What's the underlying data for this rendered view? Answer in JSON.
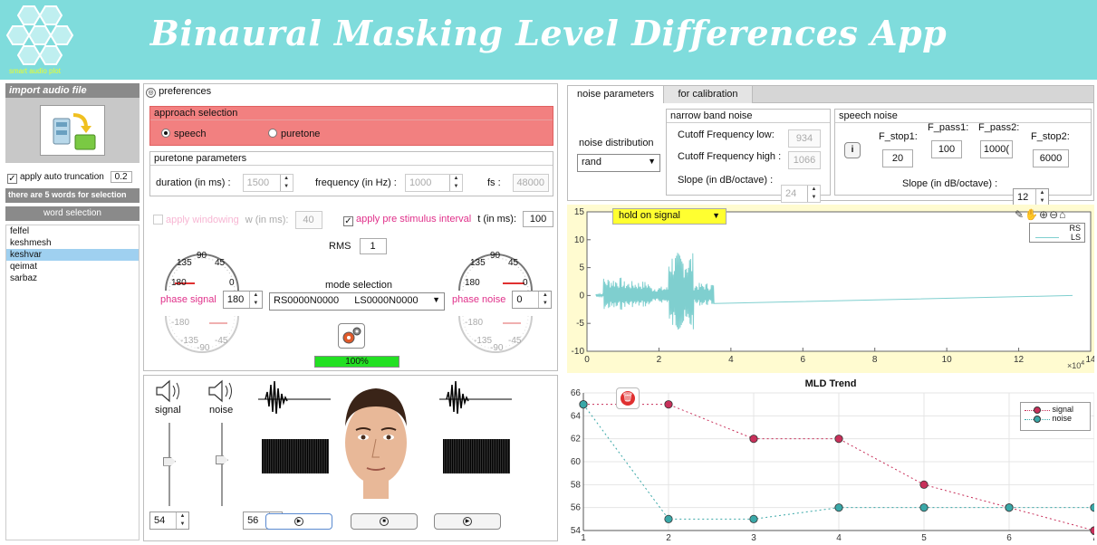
{
  "header": {
    "title": "Binaural Masking Level Differences App",
    "logo_text": "smart audio plot"
  },
  "left": {
    "import_label": "import audio file",
    "auto_trunc_label": "apply auto truncation",
    "auto_trunc_value": "0.2",
    "words_info": "there are 5 words for selection",
    "word_selection_label": "word selection",
    "words": [
      "felfel",
      "keshmesh",
      "keshvar",
      "qeimat",
      "sarbaz"
    ],
    "selected_word": "keshvar"
  },
  "prefs": {
    "title": "preferences",
    "approach": {
      "label": "approach selection",
      "speech": "speech",
      "puretone": "puretone",
      "selected": "speech"
    },
    "puretone": {
      "label": "puretone parameters",
      "duration_label": "duration (in ms) :",
      "duration": "1500",
      "freq_label": "frequency (in Hz) :",
      "freq": "1000",
      "fs_label": "fs :",
      "fs": "48000"
    },
    "windowing": {
      "label": "apply windowing",
      "w_label": "w (in ms):",
      "w": "40"
    },
    "prestim": {
      "label": "apply pre stimulus interval",
      "t_label": "t (in ms):",
      "t": "100"
    },
    "rms_label": "RMS",
    "rms": "1",
    "gauge_ticks": {
      "t90": "90",
      "t135": "135",
      "t45": "45",
      "t180": "180",
      "t0": "0",
      "tn180": "-180",
      "tn135": "-135",
      "tn45": "-45",
      "tn90": "-90"
    },
    "phase_signal_label": "phase signal",
    "phase_signal": "180",
    "phase_noise_label": "phase noise",
    "phase_noise": "0",
    "mode_label": "mode selection",
    "mode_left": "RS0000N0000",
    "mode_right": "LS0000N0000",
    "progress_text": "100%",
    "progress": 1.0
  },
  "player": {
    "signal_label": "signal",
    "noise_label": "noise",
    "signal_vol": "54",
    "noise_vol": "56",
    "signal_slider": 0.54,
    "noise_slider": 0.56
  },
  "noise_params": {
    "tabs": [
      "noise parameters",
      "for calibration"
    ],
    "dist_label": "noise distribution",
    "dist": "rand",
    "nb": {
      "title": "narrow band noise",
      "low_label": "Cutoff Frequency low:",
      "low": "934",
      "high_label": "Cutoff Frequency high :",
      "high": "1066",
      "slope_label": "Slope (in dB/octave) :",
      "slope": "24"
    },
    "sp": {
      "title": "speech noise",
      "info": "i",
      "fstop1_label": "F_stop1:",
      "fstop1": "20",
      "fpass1_label": "F_pass1:",
      "fpass1": "100",
      "fpass2_label": "F_pass2:",
      "fpass2": "1000(",
      "fstop2_label": "F_stop2:",
      "fstop2": "6000",
      "slope_label": "Slope (in dB/octave) :",
      "slope": "12"
    }
  },
  "wave_plot": {
    "dropdown": "hold on signal",
    "legend": [
      "RS",
      "LS"
    ],
    "line_color": "#7fcfcf",
    "y_ticks": [
      "15",
      "10",
      "5",
      "0",
      "-5",
      "-10"
    ],
    "x_ticks": [
      "0",
      "2",
      "4",
      "6",
      "8",
      "10",
      "12",
      "14"
    ],
    "x_exp": "×10",
    "x_exp_sup": "4"
  },
  "chart_data": {
    "type": "line",
    "title": "MLD Trend",
    "x": [
      1,
      2,
      3,
      4,
      5,
      6,
      7
    ],
    "series": [
      {
        "name": "signal",
        "values": [
          65,
          65,
          62,
          62,
          58,
          56,
          54
        ],
        "color": "#c8305a"
      },
      {
        "name": "noise",
        "values": [
          65,
          55,
          55,
          56,
          56,
          56,
          56
        ],
        "color": "#3aa8a8"
      }
    ],
    "xlim": [
      1,
      7
    ],
    "ylim": [
      54,
      66
    ],
    "x_ticks": [
      "1",
      "2",
      "3",
      "4",
      "5",
      "6",
      "7"
    ],
    "y_ticks": [
      "54",
      "56",
      "58",
      "60",
      "62",
      "64",
      "66"
    ],
    "grid": true,
    "legend": "top-right"
  }
}
